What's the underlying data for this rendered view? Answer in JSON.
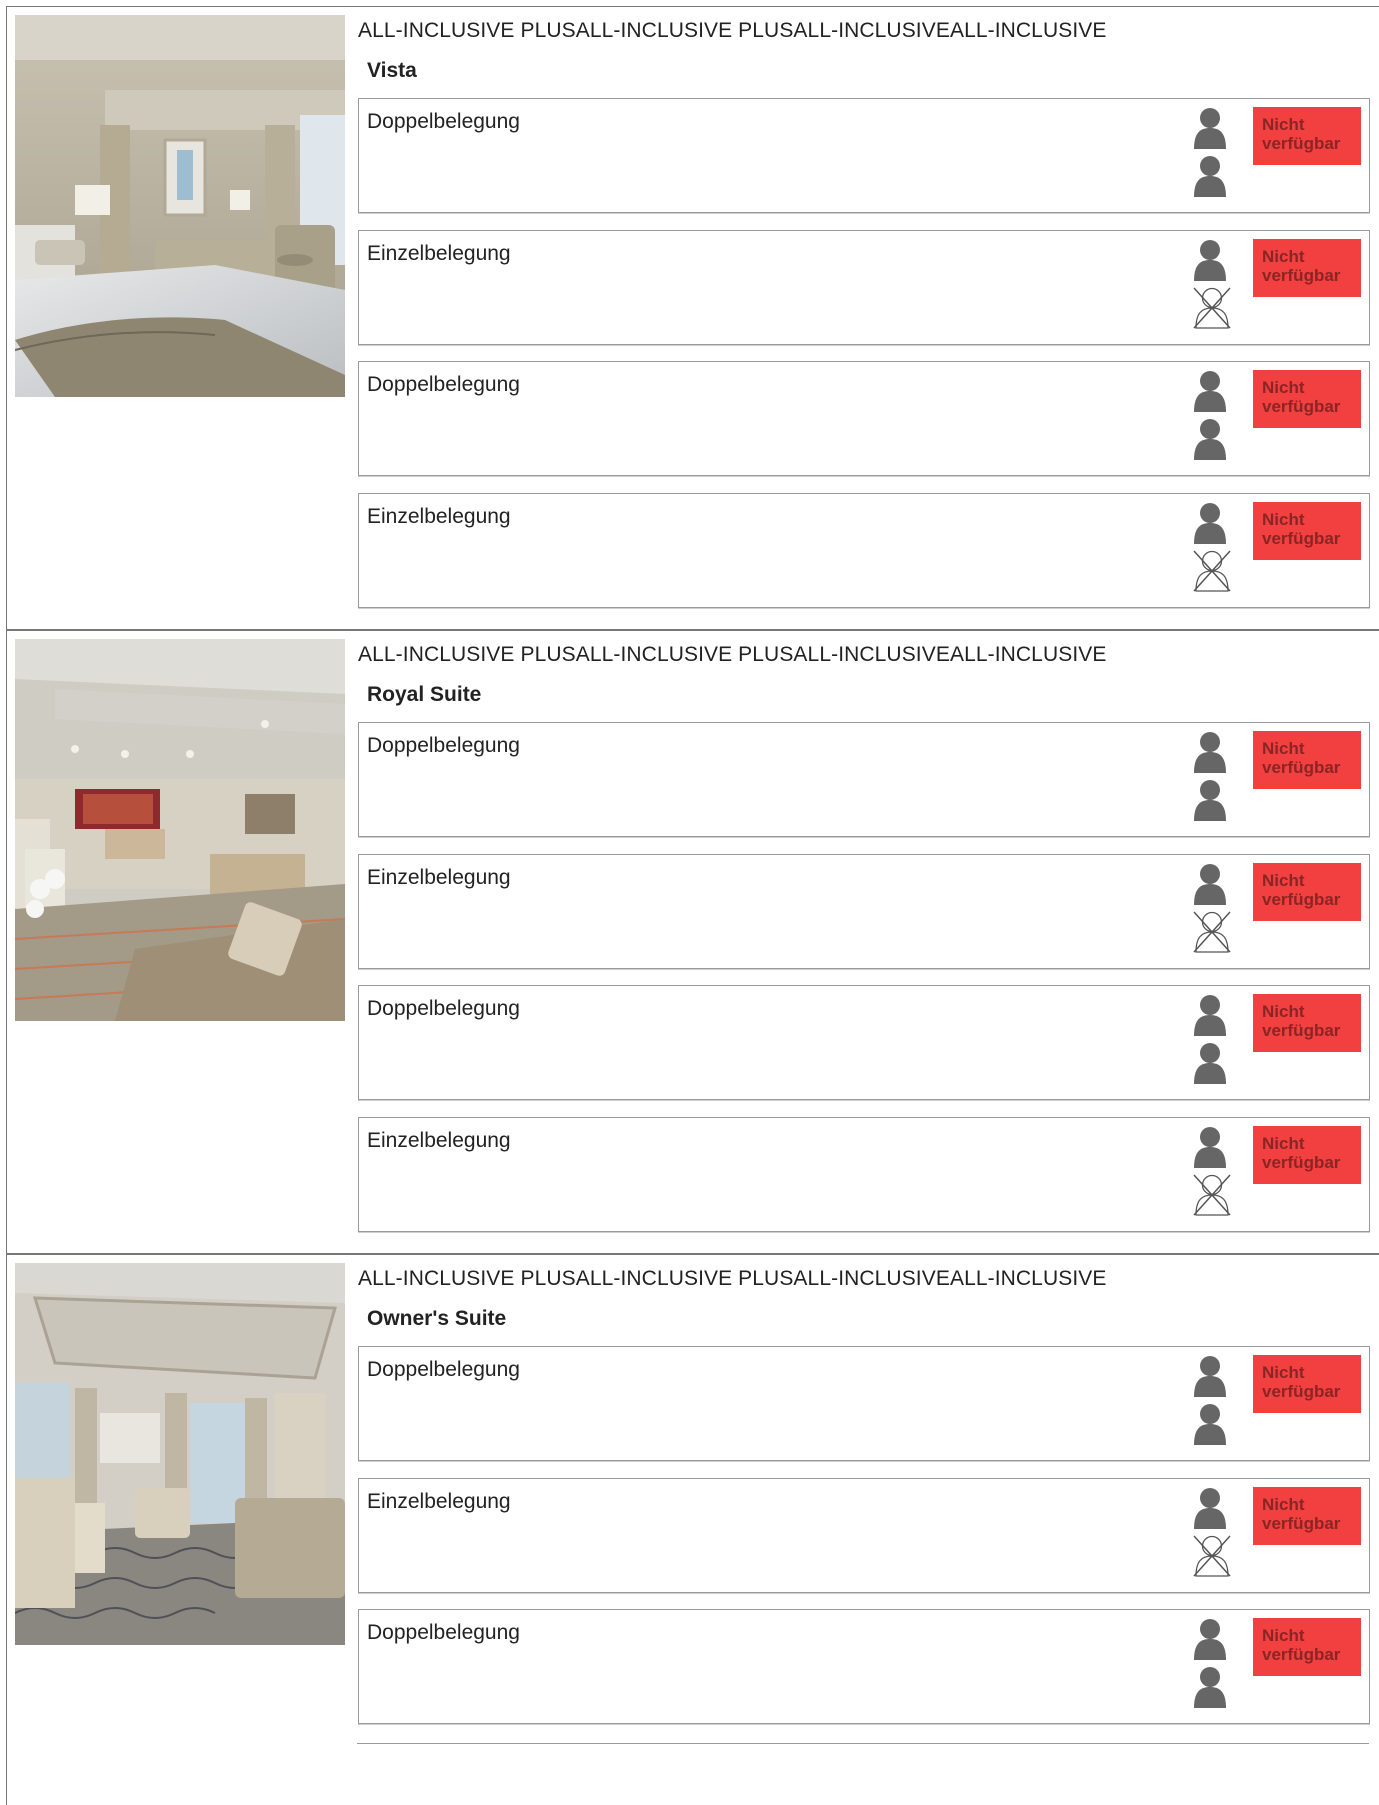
{
  "sections": [
    {
      "tags": "ALL-INCLUSIVE PLUSALL-INCLUSIVE PLUSALL-INCLUSIVEALL-INCLUSIVE",
      "name": "Vista",
      "photo": "stateroom-bedroom-photo",
      "rows": [
        {
          "label": "Doppelbelegung",
          "occupancy": 2,
          "status": "Nicht verfügbar"
        },
        {
          "label": "Einzelbelegung",
          "occupancy": 1,
          "status": "Nicht verfügbar"
        },
        {
          "label": "Doppelbelegung",
          "occupancy": 2,
          "status": "Nicht verfügbar"
        },
        {
          "label": "Einzelbelegung",
          "occupancy": 1,
          "status": "Nicht verfügbar"
        }
      ]
    },
    {
      "tags": "ALL-INCLUSIVE PLUSALL-INCLUSIVE PLUSALL-INCLUSIVEALL-INCLUSIVE",
      "name": "Royal Suite",
      "photo": "suite-living-room-photo",
      "rows": [
        {
          "label": "Doppelbelegung",
          "occupancy": 2,
          "status": "Nicht verfügbar"
        },
        {
          "label": "Einzelbelegung",
          "occupancy": 1,
          "status": "Nicht verfügbar"
        },
        {
          "label": "Doppelbelegung",
          "occupancy": 2,
          "status": "Nicht verfügbar"
        },
        {
          "label": "Einzelbelegung",
          "occupancy": 1,
          "status": "Nicht verfügbar"
        }
      ]
    },
    {
      "tags": "ALL-INCLUSIVE PLUSALL-INCLUSIVE PLUSALL-INCLUSIVEALL-INCLUSIVE",
      "name": "Owner's Suite",
      "photo": "suite-lounge-photo",
      "rows": [
        {
          "label": "Doppelbelegung",
          "occupancy": 2,
          "status": "Nicht verfügbar"
        },
        {
          "label": "Einzelbelegung",
          "occupancy": 1,
          "status": "Nicht verfügbar"
        },
        {
          "label": "Doppelbelegung",
          "occupancy": 2,
          "status": "Nicht verfügbar"
        }
      ]
    }
  ],
  "icons": {
    "guest": "person-icon",
    "no_guest": "person-crossed-icon"
  },
  "colors": {
    "status_bg": "#f24040",
    "status_text": "#8b2424",
    "icon": "#666666"
  }
}
